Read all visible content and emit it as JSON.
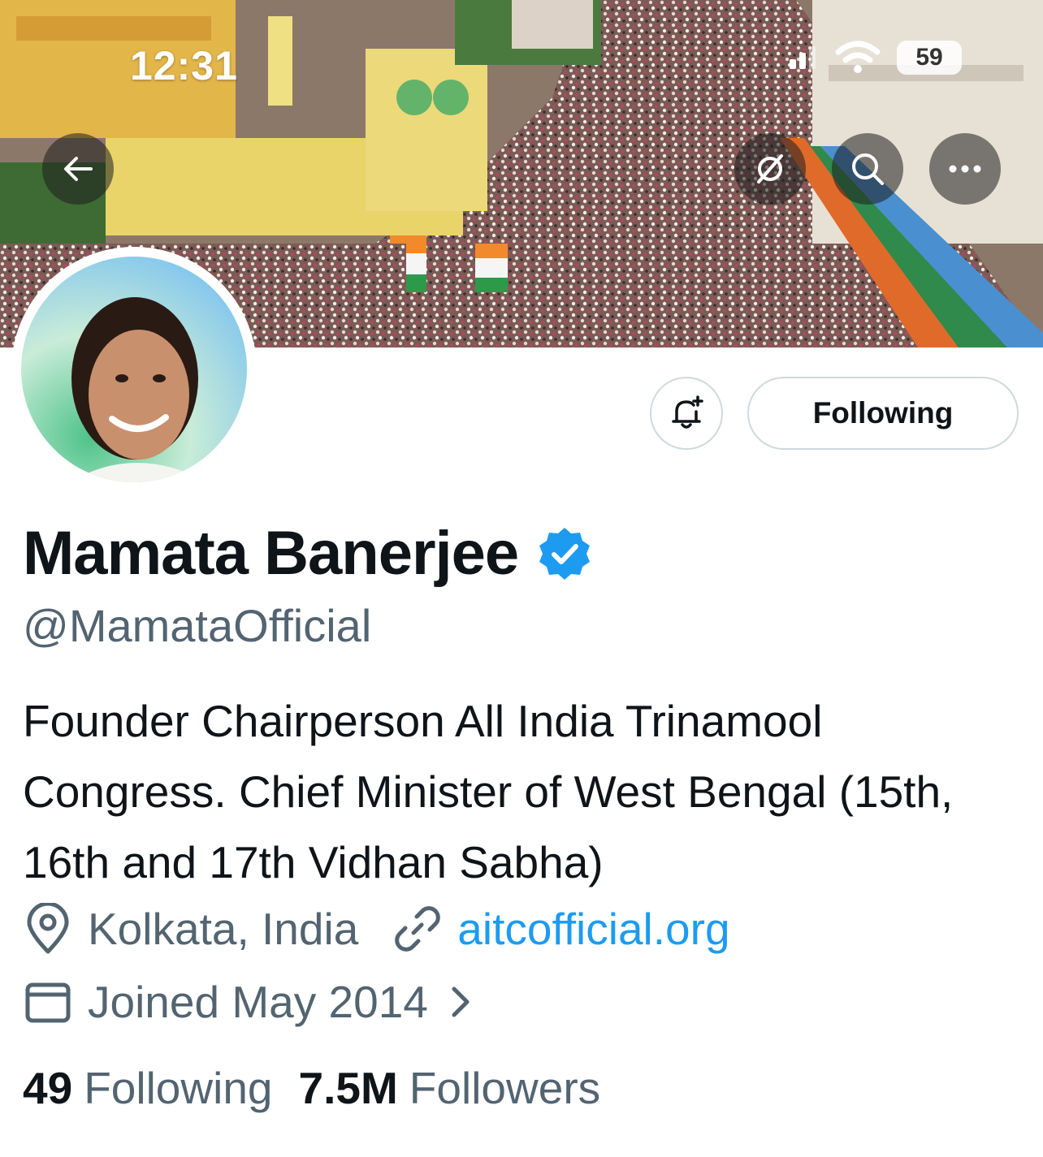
{
  "status_bar": {
    "time": "12:31",
    "battery": "59"
  },
  "header": {
    "back_icon": "back-arrow-icon",
    "icons": [
      "mute-icon",
      "search-icon",
      "more-icon"
    ]
  },
  "actions": {
    "notify_icon": "bell-plus-icon",
    "follow_label": "Following"
  },
  "profile": {
    "name": "Mamata Banerjee",
    "verified_icon": "verified-badge-icon",
    "handle": "@MamataOfficial",
    "bio": "Founder Chairperson All India Trinamool Congress. Chief Minister of West Bengal (15th, 16th and 17th Vidhan Sabha)",
    "location": "Kolkata, India",
    "website": "aitcofficial.org",
    "joined": "Joined May 2014",
    "following_count": "49",
    "following_label": "Following",
    "followers_count": "7.5M",
    "followers_label": "Followers"
  },
  "colors": {
    "accent": "#1d9bf0",
    "text": "#0f1419",
    "secondary": "#536471",
    "border": "#cfd9de"
  }
}
